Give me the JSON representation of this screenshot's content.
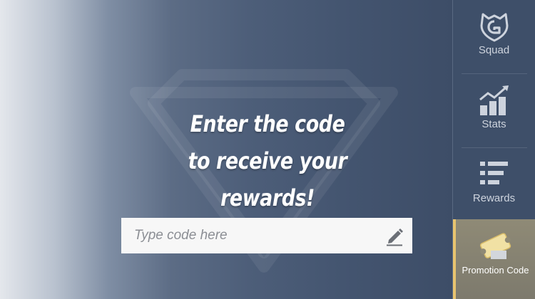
{
  "main": {
    "headline_line1": "Enter the code",
    "headline_line2": "to receive your",
    "headline_line3": "rewards!",
    "code_input": {
      "value": "",
      "placeholder": "Type code here"
    },
    "edit_icon": "pencil-icon"
  },
  "sidebar": {
    "items": [
      {
        "label": "Squad",
        "icon": "squad-shield-icon",
        "active": false
      },
      {
        "label": "Stats",
        "icon": "bar-chart-icon",
        "active": false
      },
      {
        "label": "Rewards",
        "icon": "list-icon",
        "active": false
      },
      {
        "label": "Promotion Code",
        "icon": "ticket-icon",
        "active": true
      }
    ]
  },
  "colors": {
    "sidebar_bg": "#3e4f69",
    "active_tab_bg": "#8f8a76",
    "active_accent": "#e8c46f",
    "input_bg": "#f7f7f7"
  }
}
